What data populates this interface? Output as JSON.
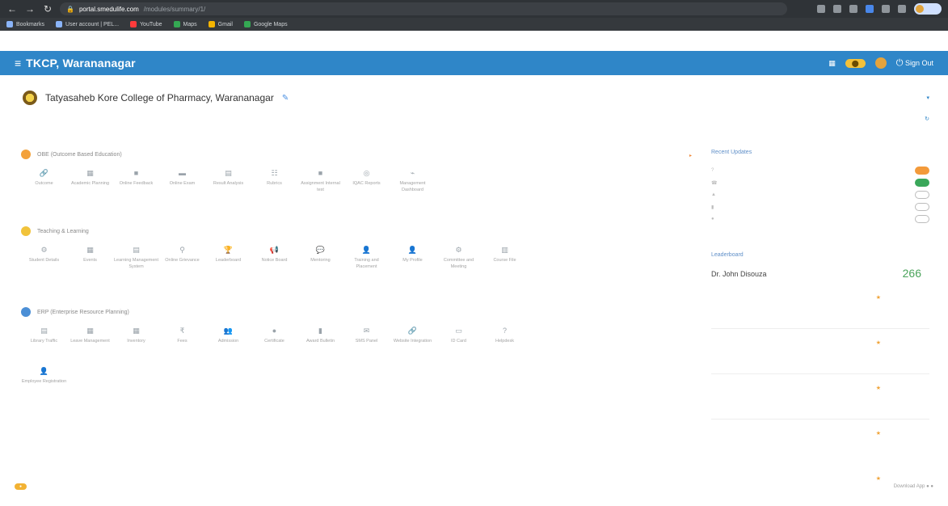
{
  "browser": {
    "url_host": "portal.smedulife.com",
    "url_path": "/modules/summary/1/",
    "bookmarks": [
      "Bookmarks",
      "User account | PEL...",
      "YouTube",
      "Maps",
      "Gmail",
      "Google Maps"
    ]
  },
  "header": {
    "title": "TKCP, Warananagar",
    "sign_out": "Sign Out"
  },
  "college": {
    "name": "Tatyasaheb Kore College of Pharmacy, Warananagar"
  },
  "sections": [
    {
      "title": "OBE (Outcome Based Education)",
      "more": "",
      "items": [
        {
          "label": "Outcome",
          "icon": "🔗"
        },
        {
          "label": "Academic Planning",
          "icon": "▦"
        },
        {
          "label": "Online Feedback",
          "icon": "■"
        },
        {
          "label": "Online Exam",
          "icon": "▬"
        },
        {
          "label": "Result Analysis",
          "icon": "▤"
        },
        {
          "label": "Rubrics",
          "icon": "☷"
        },
        {
          "label": "Assignment Internal test",
          "icon": "■"
        },
        {
          "label": "IQAC Reports",
          "icon": "◎"
        },
        {
          "label": "Management Dashboard",
          "icon": "⌁"
        }
      ]
    },
    {
      "title": "Teaching & Learning",
      "items": [
        {
          "label": "Student Details",
          "icon": "⚙"
        },
        {
          "label": "Events",
          "icon": "▦"
        },
        {
          "label": "Learning Management System",
          "icon": "▤"
        },
        {
          "label": "Online Grievance",
          "icon": "⚲"
        },
        {
          "label": "Leaderboard",
          "icon": "🏆"
        },
        {
          "label": "Notice Board",
          "icon": "📢"
        },
        {
          "label": "Mentoring",
          "icon": "💬"
        },
        {
          "label": "Training and Placement",
          "icon": "👤"
        },
        {
          "label": "My Profile",
          "icon": "👤"
        },
        {
          "label": "Committee and Meeting",
          "icon": "⚙"
        },
        {
          "label": "Course File",
          "icon": "▥"
        }
      ]
    },
    {
      "title": "ERP (Enterprise Resource Planning)",
      "items": [
        {
          "label": "Library Traffic",
          "icon": "▤"
        },
        {
          "label": "Leave Management",
          "icon": "▦"
        },
        {
          "label": "Inventory",
          "icon": "▦"
        },
        {
          "label": "Fees",
          "icon": "₹"
        },
        {
          "label": "Admission",
          "icon": "👥"
        },
        {
          "label": "Certificate",
          "icon": "●"
        },
        {
          "label": "Award Bulletin",
          "icon": "▮"
        },
        {
          "label": "SMS Panel",
          "icon": "✉"
        },
        {
          "label": "Website Integration",
          "icon": "🔗"
        },
        {
          "label": "ID Card",
          "icon": "▭"
        },
        {
          "label": "Helpdesk",
          "icon": "?"
        },
        {
          "label": "Employee Registration",
          "icon": "👤"
        }
      ]
    }
  ],
  "right_panel": {
    "recent_updates_title": "Recent Updates",
    "leaderboard_title": "Leaderboard",
    "leader_name": "Dr. John Disouza",
    "leader_score": "266"
  },
  "footer": {
    "download_app": "Download App"
  }
}
